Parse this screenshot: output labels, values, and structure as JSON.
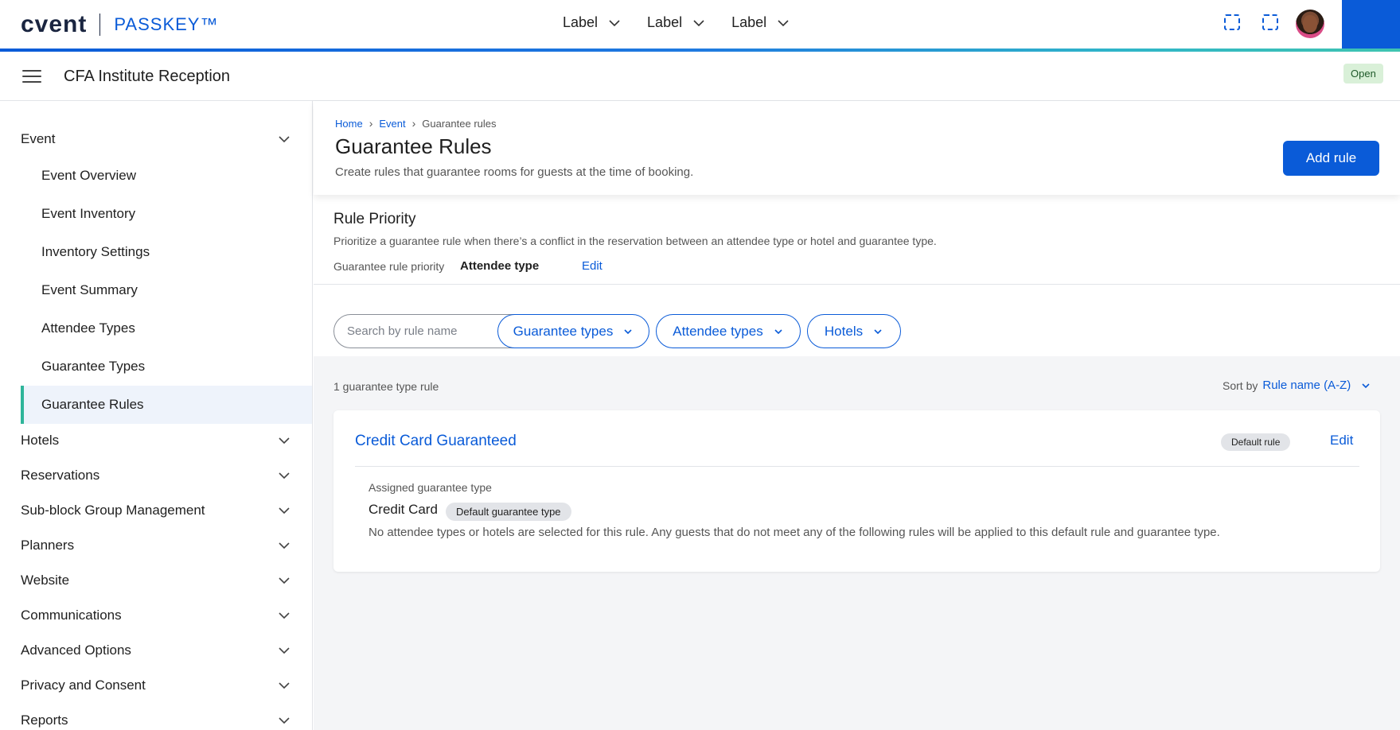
{
  "app": {
    "brand": "cvent",
    "product": "PASSKEY™",
    "brand_color": "#0a5bd8"
  },
  "topnav": [
    {
      "label": "Label"
    },
    {
      "label": "Label"
    },
    {
      "label": "Label"
    }
  ],
  "header": {
    "event_title": "CFA Institute Reception",
    "status": "Open"
  },
  "sidebar": {
    "groups_top": {
      "label": "Event"
    },
    "event_items": [
      {
        "label": "Event Overview"
      },
      {
        "label": "Event Inventory"
      },
      {
        "label": "Inventory Settings"
      },
      {
        "label": "Event Summary"
      },
      {
        "label": "Attendee Types"
      },
      {
        "label": "Guarantee Types"
      },
      {
        "label": "Guarantee Rules"
      }
    ],
    "groups": [
      {
        "label": "Hotels"
      },
      {
        "label": "Reservations"
      },
      {
        "label": "Sub-block Group Management"
      },
      {
        "label": "Planners"
      },
      {
        "label": "Website"
      },
      {
        "label": "Communications"
      },
      {
        "label": "Advanced Options"
      },
      {
        "label": "Privacy and Consent"
      },
      {
        "label": "Reports"
      }
    ]
  },
  "breadcrumb": {
    "home": "Home",
    "event": "Event",
    "current": "Guarantee rules"
  },
  "page": {
    "title": "Guarantee Rules",
    "subtitle": "Create rules that guarantee rooms for guests at the time of booking.",
    "add_button": "Add rule"
  },
  "priority": {
    "title": "Rule Priority",
    "description": "Prioritize a guarantee rule when there’s a conflict in the reservation between an attendee type or hotel and guarantee type.",
    "label": "Guarantee rule priority",
    "value": "Attendee type",
    "edit": "Edit"
  },
  "filters": {
    "search_placeholder": "Search by rule name",
    "guarantee_types": "Guarantee types",
    "attendee_types": "Attendee types",
    "hotels": "Hotels"
  },
  "results": {
    "count_text": "1 guarantee type rule",
    "sort_label": "Sort by",
    "sort_value": "Rule name (A-Z)"
  },
  "rule": {
    "title": "Credit Card Guaranteed",
    "badge": "Default rule",
    "edit": "Edit",
    "assigned_label": "Assigned guarantee type",
    "assigned_value": "Credit Card",
    "assigned_badge": "Default guarantee type",
    "description": "No attendee types or hotels are selected for this rule. Any guests that do not meet any of the following rules will be applied to this default rule and guarantee type."
  }
}
